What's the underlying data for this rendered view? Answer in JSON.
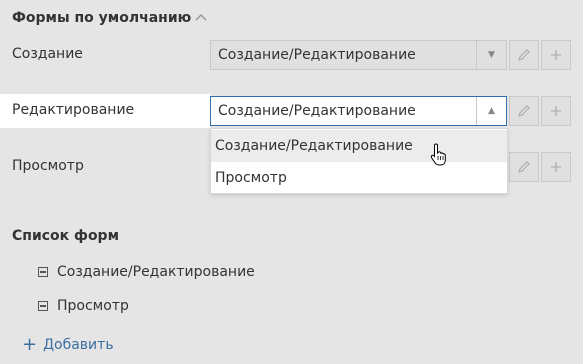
{
  "default_forms": {
    "title": "Формы по умолчанию",
    "collapse_icon": "chevron-up-icon",
    "rows": [
      {
        "label": "Создание",
        "value": "Создание/Редактирование"
      },
      {
        "label": "Редактирование",
        "value": "Создание/Редактирование"
      },
      {
        "label": "Просмотр",
        "value": ""
      }
    ],
    "dropdown_options": [
      "Создание/Редактирование",
      "Просмотр"
    ],
    "edit_icon": "pencil-icon",
    "add_icon": "plus-icon"
  },
  "form_list": {
    "title": "Список форм",
    "items": [
      "Создание/Редактирование",
      "Просмотр"
    ],
    "add_label": "Добавить"
  },
  "colors": {
    "background": "#e5e5e5",
    "accent": "#2f6fb0",
    "link": "#3c6fa0"
  }
}
